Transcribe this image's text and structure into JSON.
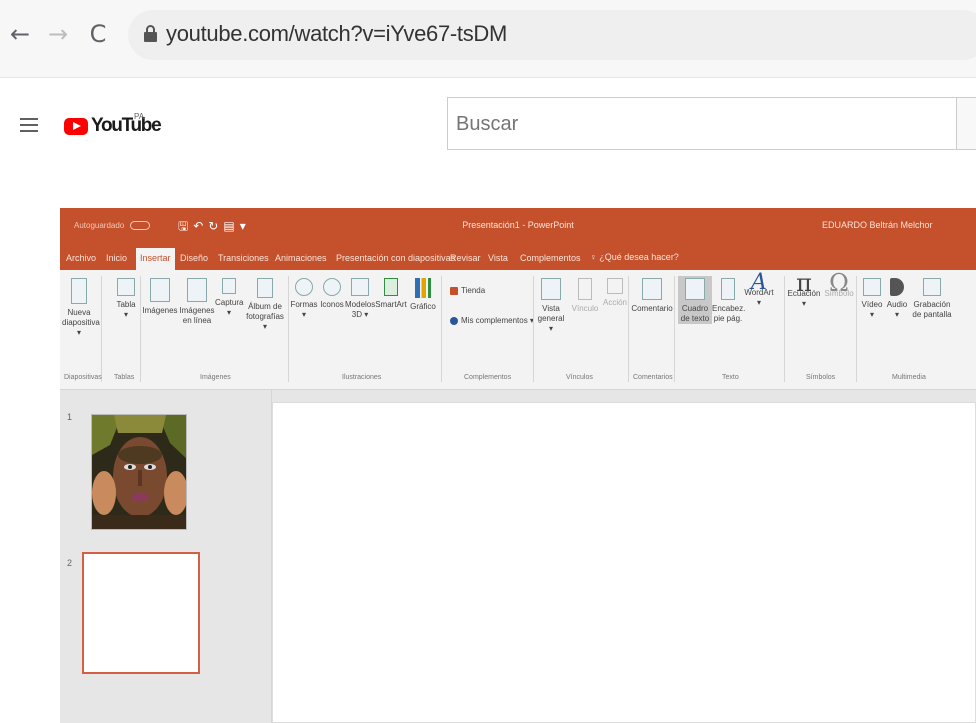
{
  "browser": {
    "back": "←",
    "forward": "→",
    "reload": "C",
    "url": "youtube.com/watch?v=iYve67-tsDM"
  },
  "youtube": {
    "logo_text": "YouTube",
    "country": "PA",
    "search_placeholder": "Buscar"
  },
  "powerpoint": {
    "autosave": "Autoguardado",
    "title": "Presentación1 - PowerPoint",
    "user": "EDUARDO Beltrán Melchor",
    "tabs": [
      "Archivo",
      "Inicio",
      "Insertar",
      "Diseño",
      "Transiciones",
      "Animaciones",
      "Presentación con diapositivas",
      "Revisar",
      "Vista",
      "Complementos"
    ],
    "tell_me": "¿Qué desea hacer?",
    "ribbon": {
      "buttons": [
        "Nueva\ndiapositiva ▾",
        "Tabla\n▾",
        "Imágenes",
        "Imágenes\nen línea",
        "Captura\n▾",
        "Álbum de\nfotografías ▾",
        "Formas\n▾",
        "Iconos",
        "Modelos\n3D ▾",
        "SmartArt",
        "Gráfico",
        "Vista\ngeneral ▾",
        "Vínculo",
        "Acción",
        "Comentario",
        "Cuadro\nde texto",
        "Encabez.\npie pág.",
        "WordArt\n▾",
        "Ecuación\n▾",
        "Símbolo",
        "Vídeo\n▾",
        "Audio\n▾",
        "Grabación\nde pantalla"
      ],
      "store": "Tienda",
      "my_addins": "Mis complementos ▾",
      "groups": [
        "Diapositivas",
        "Tablas",
        "Imágenes",
        "Ilustraciones",
        "Complementos",
        "Vínculos",
        "Comentarios",
        "Texto",
        "Símbolos",
        "Multimedia"
      ]
    },
    "slide_numbers": [
      "1",
      "2"
    ]
  }
}
